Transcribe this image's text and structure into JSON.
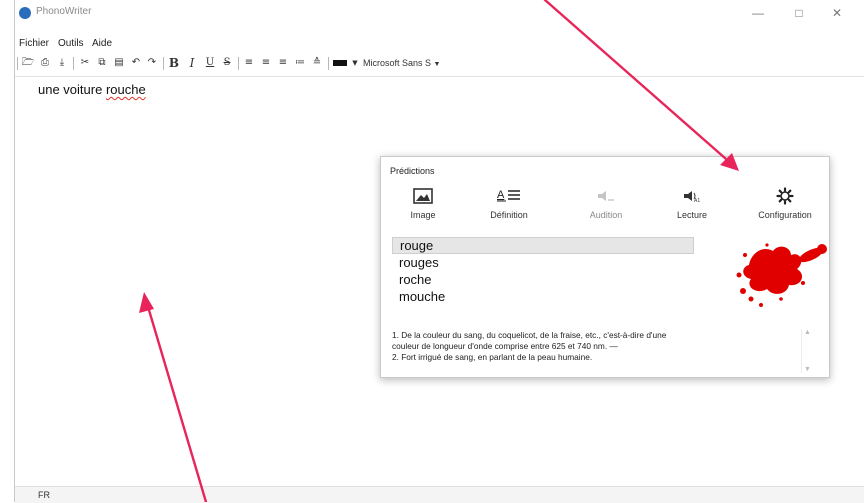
{
  "window": {
    "title": "PhonoWriter"
  },
  "menu": [
    "Fichier",
    "Outils",
    "Aide"
  ],
  "toolbar": {
    "font_name": "Microsoft Sans S",
    "color_swatch": "#111111"
  },
  "document": {
    "text_before": "une voiture ",
    "misspelled_word": "rouche"
  },
  "status": {
    "language": "FR"
  },
  "predictions": {
    "title": "Prédictions",
    "buttons": [
      {
        "label": "Image",
        "icon": "image-icon",
        "enabled": true
      },
      {
        "label": "Définition",
        "icon": "definition-icon",
        "enabled": true
      },
      {
        "label": "Audition",
        "icon": "audition-icon",
        "enabled": false
      },
      {
        "label": "Lecture",
        "icon": "lecture-icon",
        "enabled": true
      },
      {
        "label": "Configuration",
        "icon": "gear-icon",
        "enabled": true
      }
    ],
    "suggestions": [
      "rouge",
      "rouges",
      "roche",
      "mouche"
    ],
    "selected_index": 0,
    "definition": [
      "1. De la couleur du sang, du coquelicot, de la fraise, etc., c'est-à-dire d'une",
      "couleur de longueur d'onde comprise entre 625 et 740 nm. —",
      "2. Fort irrigué de sang, en parlant de la peau humaine."
    ]
  },
  "colors": {
    "annotation_arrow": "#e8245a",
    "splat": "#e00000",
    "spell_underline": "#e0312b"
  }
}
